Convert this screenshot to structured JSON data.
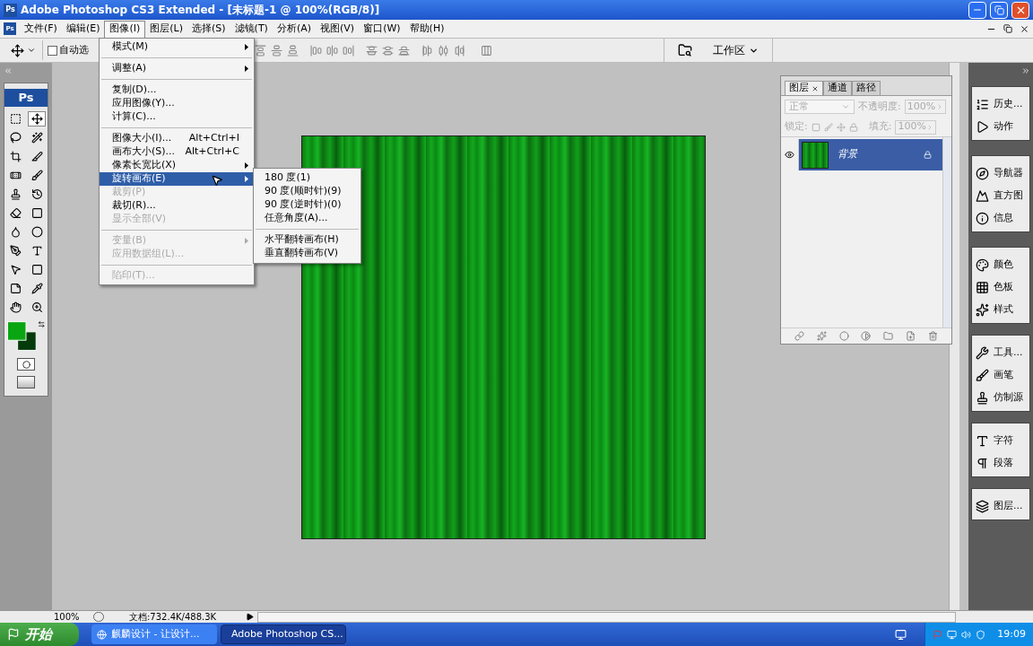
{
  "window": {
    "icon": "Ps",
    "title": "Adobe Photoshop CS3 Extended - [未标题-1 @ 100%(RGB/8)]"
  },
  "menu_bar": {
    "icon": "Ps",
    "items": [
      {
        "label": "文件(F)",
        "selected": false
      },
      {
        "label": "编辑(E)",
        "selected": false
      },
      {
        "label": "图像(I)",
        "selected": true
      },
      {
        "label": "图层(L)",
        "selected": false
      },
      {
        "label": "选择(S)",
        "selected": false
      },
      {
        "label": "滤镜(T)",
        "selected": false
      },
      {
        "label": "分析(A)",
        "selected": false
      },
      {
        "label": "视图(V)",
        "selected": false
      },
      {
        "label": "窗口(W)",
        "selected": false
      },
      {
        "label": "帮助(H)",
        "selected": false
      }
    ]
  },
  "options_bar": {
    "auto_select": {
      "label": "自动选",
      "checked": false
    },
    "workspace": "工作区"
  },
  "image_menu": [
    {
      "kind": "item",
      "label": "模式(M)",
      "submenu": true,
      "disabled": false,
      "selected": false
    },
    {
      "kind": "separator"
    },
    {
      "kind": "item",
      "label": "调整(A)",
      "submenu": true,
      "disabled": false,
      "selected": false
    },
    {
      "kind": "separator"
    },
    {
      "kind": "item",
      "label": "复制(D)...",
      "disabled": false,
      "selected": false
    },
    {
      "kind": "item",
      "label": "应用图像(Y)...",
      "disabled": false,
      "selected": false
    },
    {
      "kind": "item",
      "label": "计算(C)...",
      "disabled": false,
      "selected": false
    },
    {
      "kind": "separator"
    },
    {
      "kind": "item",
      "label": "图像大小(I)...",
      "shortcut": "Alt+Ctrl+I",
      "disabled": false,
      "selected": false
    },
    {
      "kind": "item",
      "label": "画布大小(S)...",
      "shortcut": "Alt+Ctrl+C",
      "disabled": false,
      "selected": false
    },
    {
      "kind": "item",
      "label": "像素长宽比(X)",
      "submenu": true,
      "disabled": false,
      "selected": false
    },
    {
      "kind": "item",
      "label": "旋转画布(E)",
      "submenu": true,
      "disabled": false,
      "selected": true
    },
    {
      "kind": "item",
      "label": "裁剪(P)",
      "disabled": true,
      "selected": false
    },
    {
      "kind": "item",
      "label": "裁切(R)...",
      "disabled": false,
      "selected": false
    },
    {
      "kind": "item",
      "label": "显示全部(V)",
      "disabled": true,
      "selected": false
    },
    {
      "kind": "separator"
    },
    {
      "kind": "item",
      "label": "变量(B)",
      "submenu": true,
      "disabled": true,
      "selected": false
    },
    {
      "kind": "item",
      "label": "应用数据组(L)...",
      "disabled": true,
      "selected": false
    },
    {
      "kind": "separator"
    },
    {
      "kind": "item",
      "label": "陷印(T)...",
      "disabled": true,
      "selected": false
    }
  ],
  "rotate_submenu": [
    {
      "kind": "item",
      "label": "180 度(1)"
    },
    {
      "kind": "item",
      "label": "90 度(顺时针)(9)"
    },
    {
      "kind": "item",
      "label": "90 度(逆时针)(0)"
    },
    {
      "kind": "item",
      "label": "任意角度(A)..."
    },
    {
      "kind": "separator"
    },
    {
      "kind": "item",
      "label": "水平翻转画布(H)"
    },
    {
      "kind": "item",
      "label": "垂直翻转画布(V)"
    }
  ],
  "toolbox": {
    "logo": "Ps",
    "tools": [
      {
        "kind": "marquee",
        "selected": false
      },
      {
        "kind": "move",
        "selected": true
      },
      {
        "kind": "lasso",
        "selected": false
      },
      {
        "kind": "wand",
        "selected": false
      },
      {
        "kind": "crop",
        "selected": false
      },
      {
        "kind": "slice",
        "selected": false
      },
      {
        "kind": "heal",
        "selected": false
      },
      {
        "kind": "brush",
        "selected": false
      },
      {
        "kind": "stamp",
        "selected": false
      },
      {
        "kind": "history",
        "selected": false
      },
      {
        "kind": "eraser",
        "selected": false
      },
      {
        "kind": "gradient",
        "selected": false
      },
      {
        "kind": "blur",
        "selected": false
      },
      {
        "kind": "dodge",
        "selected": false
      },
      {
        "kind": "pen",
        "selected": false
      },
      {
        "kind": "type",
        "selected": false
      },
      {
        "kind": "path",
        "selected": false
      },
      {
        "kind": "shape",
        "selected": false
      },
      {
        "kind": "notes",
        "selected": false
      },
      {
        "kind": "eyedropper",
        "selected": false
      },
      {
        "kind": "hand",
        "selected": false
      },
      {
        "kind": "zoom",
        "selected": false
      }
    ]
  },
  "layers_panel": {
    "tabs": [
      {
        "label": "图层",
        "selected": true
      },
      {
        "label": "通道",
        "selected": false
      },
      {
        "label": "路径",
        "selected": false
      }
    ],
    "blend_mode": "正常",
    "opacity_label": "不透明度:",
    "opacity": "100%",
    "lock_label": "锁定:",
    "fill_label": "填充:",
    "fill": "100%",
    "layers": [
      {
        "name": "背景",
        "selected": true,
        "visible": true,
        "locked": true
      }
    ]
  },
  "dock": [
    [
      {
        "kind": "history",
        "label": "历史..."
      },
      {
        "kind": "actions",
        "label": "动作"
      }
    ],
    [
      {
        "kind": "navigator",
        "label": "导航器"
      },
      {
        "kind": "histogram",
        "label": "直方图"
      },
      {
        "kind": "info",
        "label": "信息"
      }
    ],
    [
      {
        "kind": "color",
        "label": "颜色"
      },
      {
        "kind": "swatches",
        "label": "色板"
      },
      {
        "kind": "styles",
        "label": "样式"
      }
    ],
    [
      {
        "kind": "tools",
        "label": "工具..."
      },
      {
        "kind": "brushes",
        "label": "画笔"
      },
      {
        "kind": "clone",
        "label": "仿制源"
      }
    ],
    [
      {
        "kind": "character",
        "label": "字符"
      },
      {
        "kind": "paragraph",
        "label": "段落"
      }
    ],
    [
      {
        "kind": "layers",
        "label": "图层..."
      }
    ]
  ],
  "status_bar": {
    "zoom": "100%",
    "document": "文档:732.4K/488.3K"
  },
  "taskbar": {
    "start": "开始",
    "tasks": [
      {
        "label": "麒麟设计 - 让设计...",
        "selected": false
      },
      {
        "label": "Adobe Photoshop CS...",
        "selected": true
      }
    ],
    "clock": "19:09"
  }
}
